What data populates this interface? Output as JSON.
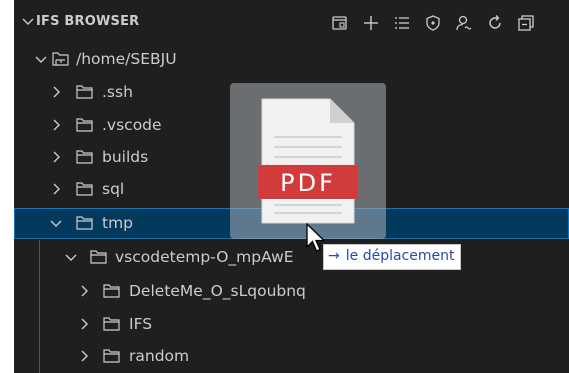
{
  "panel": {
    "title": "IFS BROWSER"
  },
  "toolbar": {
    "actions": [
      {
        "icon": "open-editor-icon"
      },
      {
        "icon": "add-icon"
      },
      {
        "icon": "list-icon"
      },
      {
        "icon": "shield-icon"
      },
      {
        "icon": "user-search-icon"
      },
      {
        "icon": "refresh-icon"
      },
      {
        "icon": "collapse-all-icon"
      }
    ]
  },
  "tree": {
    "root": "/home/SEBJU",
    "items": [
      {
        "label": ".ssh",
        "expanded": false
      },
      {
        "label": ".vscode",
        "expanded": false
      },
      {
        "label": "builds",
        "expanded": false
      },
      {
        "label": "sql",
        "expanded": false
      },
      {
        "label": "tmp",
        "expanded": true,
        "selected": true
      },
      {
        "label": "vscodetemp-O_mpAwE",
        "expanded": true
      },
      {
        "label": "DeleteMe_O_sLqoubnq",
        "expanded": false
      },
      {
        "label": "IFS",
        "expanded": false
      },
      {
        "label": "random",
        "expanded": false
      }
    ]
  },
  "drag": {
    "file_label": "PDF",
    "tooltip_arrow": "→",
    "tooltip_text": "le déplacement"
  },
  "colors": {
    "background": "#1f1f1f",
    "text": "#cccccc",
    "selection": "#04395e",
    "selection_border": "#0078d4",
    "pdf_red": "#d13b3b",
    "tooltip_text": "#2b4aa0"
  }
}
